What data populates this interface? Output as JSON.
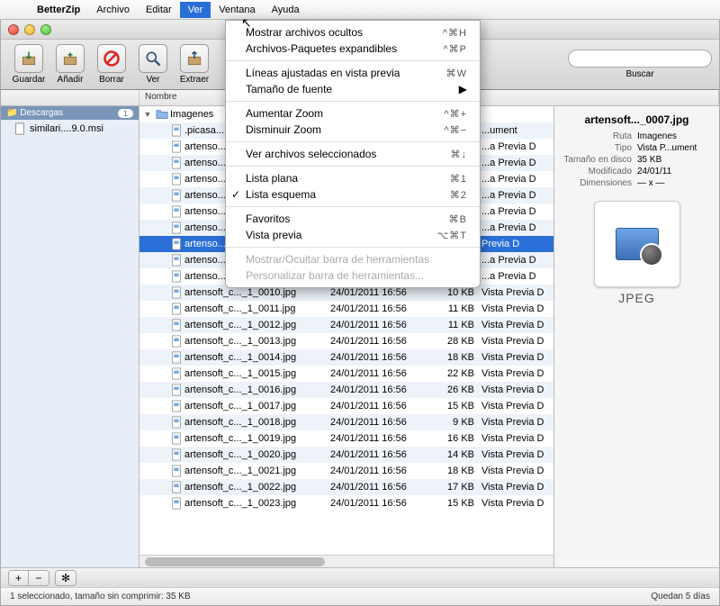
{
  "menubar": {
    "app": "BetterZip",
    "items": [
      "Archivo",
      "Editar",
      "Ver",
      "Ventana",
      "Ayuda"
    ],
    "selected": 2
  },
  "dropdown": [
    {
      "label": "Mostrar archivos ocultos",
      "sc": "^⌘H"
    },
    {
      "label": "Archivos-Paquetes expandibles",
      "sc": "^⌘P"
    },
    {
      "sep": true
    },
    {
      "label": "Líneas ajustadas en vista previa",
      "sc": "⌘W"
    },
    {
      "label": "Tamaño de fuente",
      "arrow": "▶"
    },
    {
      "sep": true
    },
    {
      "label": "Aumentar Zoom",
      "sc": "^⌘+"
    },
    {
      "label": "Disminuir Zoom",
      "sc": "^⌘−"
    },
    {
      "sep": true
    },
    {
      "label": "Ver archivos seleccionados",
      "sc": "⌘↓"
    },
    {
      "sep": true
    },
    {
      "label": "Lista plana",
      "sc": "⌘1"
    },
    {
      "label": "Lista esquema",
      "sc": "⌘2",
      "checked": true
    },
    {
      "sep": true
    },
    {
      "label": "Favoritos",
      "sc": "⌘B"
    },
    {
      "label": "Vista previa",
      "sc": "⌥⌘T"
    },
    {
      "sep": true
    },
    {
      "label": "Mostrar/Ocultar barra de herramientas",
      "disabled": true
    },
    {
      "label": "Personalizar barra de herramientas...",
      "disabled": true
    }
  ],
  "toolbar": {
    "buttons": [
      {
        "name": "guardar",
        "label": "Guardar",
        "svg": "box-down"
      },
      {
        "name": "anadir",
        "label": "Añadir",
        "svg": "box-plus"
      },
      {
        "name": "borrar",
        "label": "Borrar",
        "svg": "no"
      },
      {
        "name": "ver",
        "label": "Ver",
        "svg": "mag"
      },
      {
        "name": "extraer",
        "label": "Extraer",
        "svg": "box-up"
      }
    ],
    "search_label": "Buscar",
    "search_placeholder": ""
  },
  "columns": [
    "Nombre"
  ],
  "sidebar": {
    "header": "Descargas",
    "count": "1",
    "items": [
      {
        "label": "similari....9.0.msi"
      }
    ]
  },
  "folder": {
    "name": "Imagenes"
  },
  "files": [
    {
      "name": ".picasa...",
      "date": "",
      "size": "",
      "kind": "...ument",
      "hidden": true
    },
    {
      "name": "artenso...",
      "date": "",
      "size": "",
      "kind": "...a Previa D",
      "hidden": true
    },
    {
      "name": "artenso...",
      "date": "",
      "size": "",
      "kind": "...a Previa D",
      "hidden": true
    },
    {
      "name": "artenso...",
      "date": "",
      "size": "",
      "kind": "...a Previa D",
      "hidden": true
    },
    {
      "name": "artenso...",
      "date": "",
      "size": "",
      "kind": "...a Previa D",
      "hidden": true
    },
    {
      "name": "artenso...",
      "date": "",
      "size": "",
      "kind": "...a Previa D",
      "hidden": true
    },
    {
      "name": "artenso...",
      "date": "",
      "size": "",
      "kind": "...a Previa D",
      "hidden": true
    },
    {
      "name": "artenso...",
      "date": "",
      "size": "",
      "kind": "Previa D",
      "selected": true
    },
    {
      "name": "artenso...",
      "date": "",
      "size": "",
      "kind": "...a Previa D",
      "hidden": true
    },
    {
      "name": "artenso...",
      "date": "",
      "size": "",
      "kind": "...a Previa D",
      "hidden": true
    },
    {
      "name": "artensoft_c..._1_0010.jpg",
      "date": "24/01/2011 16:56",
      "size": "10 KB",
      "kind": "Vista Previa D"
    },
    {
      "name": "artensoft_c..._1_0011.jpg",
      "date": "24/01/2011 16:56",
      "size": "11 KB",
      "kind": "Vista Previa D"
    },
    {
      "name": "artensoft_c..._1_0012.jpg",
      "date": "24/01/2011 16:56",
      "size": "11 KB",
      "kind": "Vista Previa D"
    },
    {
      "name": "artensoft_c..._1_0013.jpg",
      "date": "24/01/2011 16:56",
      "size": "28 KB",
      "kind": "Vista Previa D"
    },
    {
      "name": "artensoft_c..._1_0014.jpg",
      "date": "24/01/2011 16:56",
      "size": "18 KB",
      "kind": "Vista Previa D"
    },
    {
      "name": "artensoft_c..._1_0015.jpg",
      "date": "24/01/2011 16:56",
      "size": "22 KB",
      "kind": "Vista Previa D"
    },
    {
      "name": "artensoft_c..._1_0016.jpg",
      "date": "24/01/2011 16:56",
      "size": "26 KB",
      "kind": "Vista Previa D"
    },
    {
      "name": "artensoft_c..._1_0017.jpg",
      "date": "24/01/2011 16:56",
      "size": "15 KB",
      "kind": "Vista Previa D"
    },
    {
      "name": "artensoft_c..._1_0018.jpg",
      "date": "24/01/2011 16:56",
      "size": "9 KB",
      "kind": "Vista Previa D"
    },
    {
      "name": "artensoft_c..._1_0019.jpg",
      "date": "24/01/2011 16:56",
      "size": "16 KB",
      "kind": "Vista Previa D"
    },
    {
      "name": "artensoft_c..._1_0020.jpg",
      "date": "24/01/2011 16:56",
      "size": "14 KB",
      "kind": "Vista Previa D"
    },
    {
      "name": "artensoft_c..._1_0021.jpg",
      "date": "24/01/2011 16:56",
      "size": "18 KB",
      "kind": "Vista Previa D"
    },
    {
      "name": "artensoft_c..._1_0022.jpg",
      "date": "24/01/2011 16:56",
      "size": "17 KB",
      "kind": "Vista Previa D"
    },
    {
      "name": "artensoft_c..._1_0023.jpg",
      "date": "24/01/2011 16:56",
      "size": "15 KB",
      "kind": "Vista Previa D"
    }
  ],
  "preview": {
    "title": "artensoft..._0007.jpg",
    "rows": [
      {
        "k": "Ruta",
        "v": "Imagenes"
      },
      {
        "k": "Tipo",
        "v": "Vista P...ument"
      },
      {
        "k": "Tamaño en disco",
        "v": "35 KB"
      },
      {
        "k": "Modificado",
        "v": "24/01/11"
      },
      {
        "k": "Dimensiones",
        "v": "— x —"
      }
    ],
    "thumb_label": "JPEG"
  },
  "footer": {
    "plus": "+",
    "minus": "−",
    "gear": "✻"
  },
  "status": {
    "left": "1 seleccionado, tamaño sin comprimir: 35 KB",
    "right": "Quedan 5 días"
  }
}
